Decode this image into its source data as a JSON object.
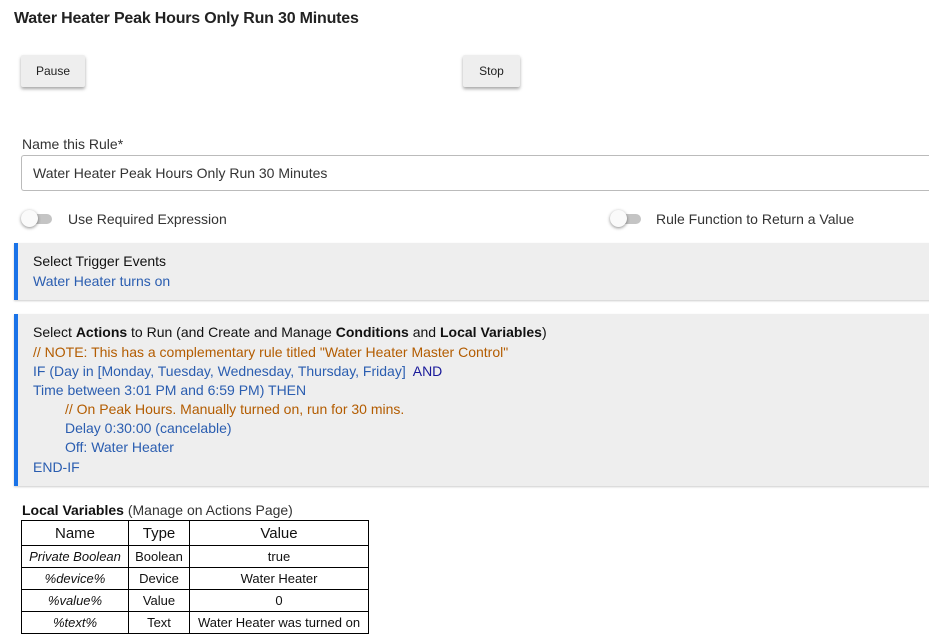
{
  "page": {
    "title": "Water Heater Peak Hours Only Run 30 Minutes"
  },
  "buttons": {
    "pause": "Pause",
    "stop": "Stop"
  },
  "rule_name": {
    "label": "Name this Rule*",
    "value": "Water Heater Peak Hours Only Run 30 Minutes"
  },
  "toggles": {
    "required_expression": {
      "label": "Use Required Expression",
      "on": false
    },
    "return_value": {
      "label": "Rule Function to Return a Value",
      "on": false
    }
  },
  "trigger_panel": {
    "heading": "Select Trigger Events",
    "events": [
      "Water Heater turns on"
    ]
  },
  "actions_panel": {
    "heading_parts": {
      "p1": "Select ",
      "b1": "Actions",
      "p2": " to Run (and Create and Manage ",
      "b2": "Conditions",
      "p3": " and ",
      "b3": "Local Variables",
      "p4": ")"
    },
    "lines": {
      "note": "// NOTE: This has a complementary rule titled \"Water Heater Master Control\"",
      "if_line": "IF (Day in [Monday, Tuesday, Wednesday, Thursday, Friday] ",
      "and_word": "AND",
      "time_line": "Time between 3:01 PM and 6:59 PM) THEN",
      "comment": "// On Peak Hours. Manually turned on, run for 30 mins.",
      "delay": "Delay 0:30:00 (cancelable)",
      "off": "Off: Water Heater",
      "end_if": "END-IF"
    }
  },
  "local_variables": {
    "heading": "Local Variables",
    "subheading": " (Manage on Actions Page)",
    "columns": [
      "Name",
      "Type",
      "Value"
    ],
    "rows": [
      [
        "Private Boolean",
        "Boolean",
        "true"
      ],
      [
        "%device%",
        "Device",
        "Water Heater"
      ],
      [
        "%value%",
        "Value",
        "0"
      ],
      [
        "%text%",
        "Text",
        "Water Heater was turned on"
      ]
    ]
  },
  "colors": {
    "accent_blue": "#1a73e8",
    "code_blue": "#2a5db0",
    "comment_orange": "#b35c00",
    "panel_gray": "#eeeeee"
  }
}
